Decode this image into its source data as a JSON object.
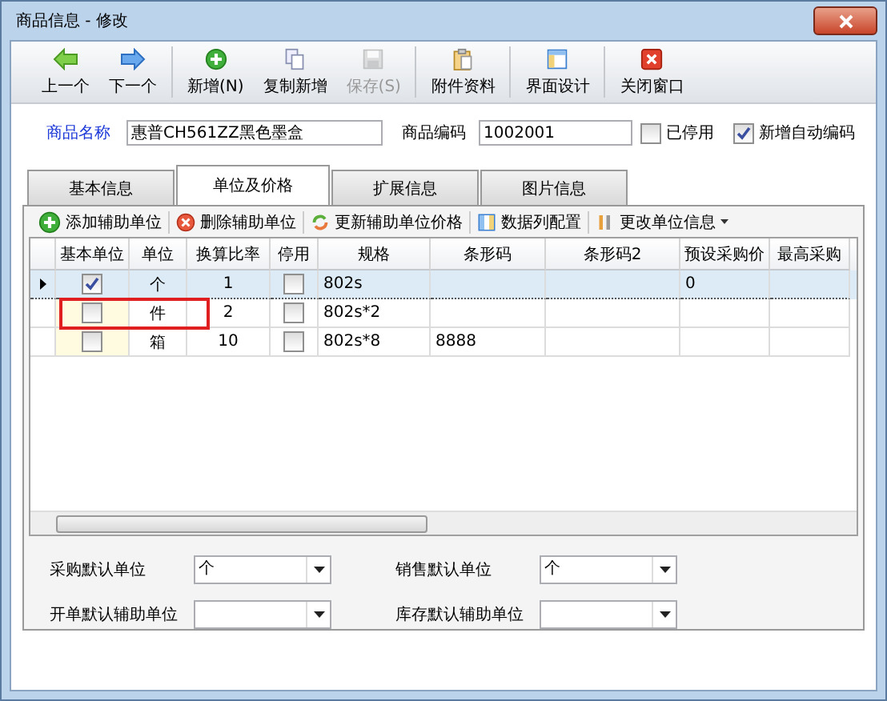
{
  "window": {
    "title": "商品信息 - 修改"
  },
  "toolbar": [
    [
      {
        "label": "上一个",
        "disabled": false
      },
      {
        "label": "下一个",
        "disabled": false
      }
    ],
    [
      {
        "label": "新增(N)",
        "disabled": false
      },
      {
        "label": "复制新增",
        "disabled": false
      },
      {
        "label": "保存(S)",
        "disabled": true
      }
    ],
    [
      {
        "label": "附件资料",
        "disabled": false
      }
    ],
    [
      {
        "label": "界面设计",
        "disabled": false
      }
    ],
    [
      {
        "label": "关闭窗口",
        "disabled": false
      }
    ]
  ],
  "form": {
    "name_label": "商品名称",
    "name_value": "惠普CH561ZZ黑色墨盒",
    "code_label": "商品编码",
    "code_value": "1002001",
    "checks": [
      {
        "label": "已停用",
        "checked": false
      },
      {
        "label": "新增自动编码",
        "checked": true
      }
    ]
  },
  "tabs": [
    {
      "label": "基本信息",
      "selected": false
    },
    {
      "label": "单位及价格",
      "selected": true
    },
    {
      "label": "扩展信息",
      "selected": false
    },
    {
      "label": "图片信息",
      "selected": false
    }
  ],
  "grid_toolbar": [
    {
      "label": "添加辅助单位",
      "dropdown": false
    },
    {
      "label": "删除辅助单位",
      "dropdown": false
    },
    {
      "label": "更新辅助单位价格",
      "dropdown": false
    },
    {
      "label": "数据列配置",
      "dropdown": false
    },
    {
      "label": "更改单位信息",
      "dropdown": true
    }
  ],
  "grid": {
    "columns": [
      "基本单位",
      "单位",
      "换算比率",
      "停用",
      "规格",
      "条形码",
      "条形码2",
      "预设采购价",
      "最高采购"
    ],
    "rows": [
      {
        "selected": true,
        "highlighted": false,
        "base_unit": true,
        "unit": "个",
        "ratio": "1",
        "disabled": false,
        "spec": "802s",
        "purchase_price": "0"
      },
      {
        "selected": false,
        "highlighted": true,
        "base_unit": false,
        "unit": "件",
        "ratio": "2",
        "disabled": false,
        "spec": "802s*2"
      },
      {
        "selected": false,
        "highlighted": false,
        "base_unit": false,
        "unit": "箱",
        "ratio": "10",
        "disabled": false,
        "spec": "802s*8",
        "barcode": "8888"
      }
    ]
  },
  "defaults": [
    {
      "label": "采购默认单位",
      "value": "个"
    },
    {
      "label": "销售默认单位",
      "value": "个"
    },
    {
      "label": "开单默认辅助单位"
    },
    {
      "label": "库存默认辅助单位"
    }
  ]
}
